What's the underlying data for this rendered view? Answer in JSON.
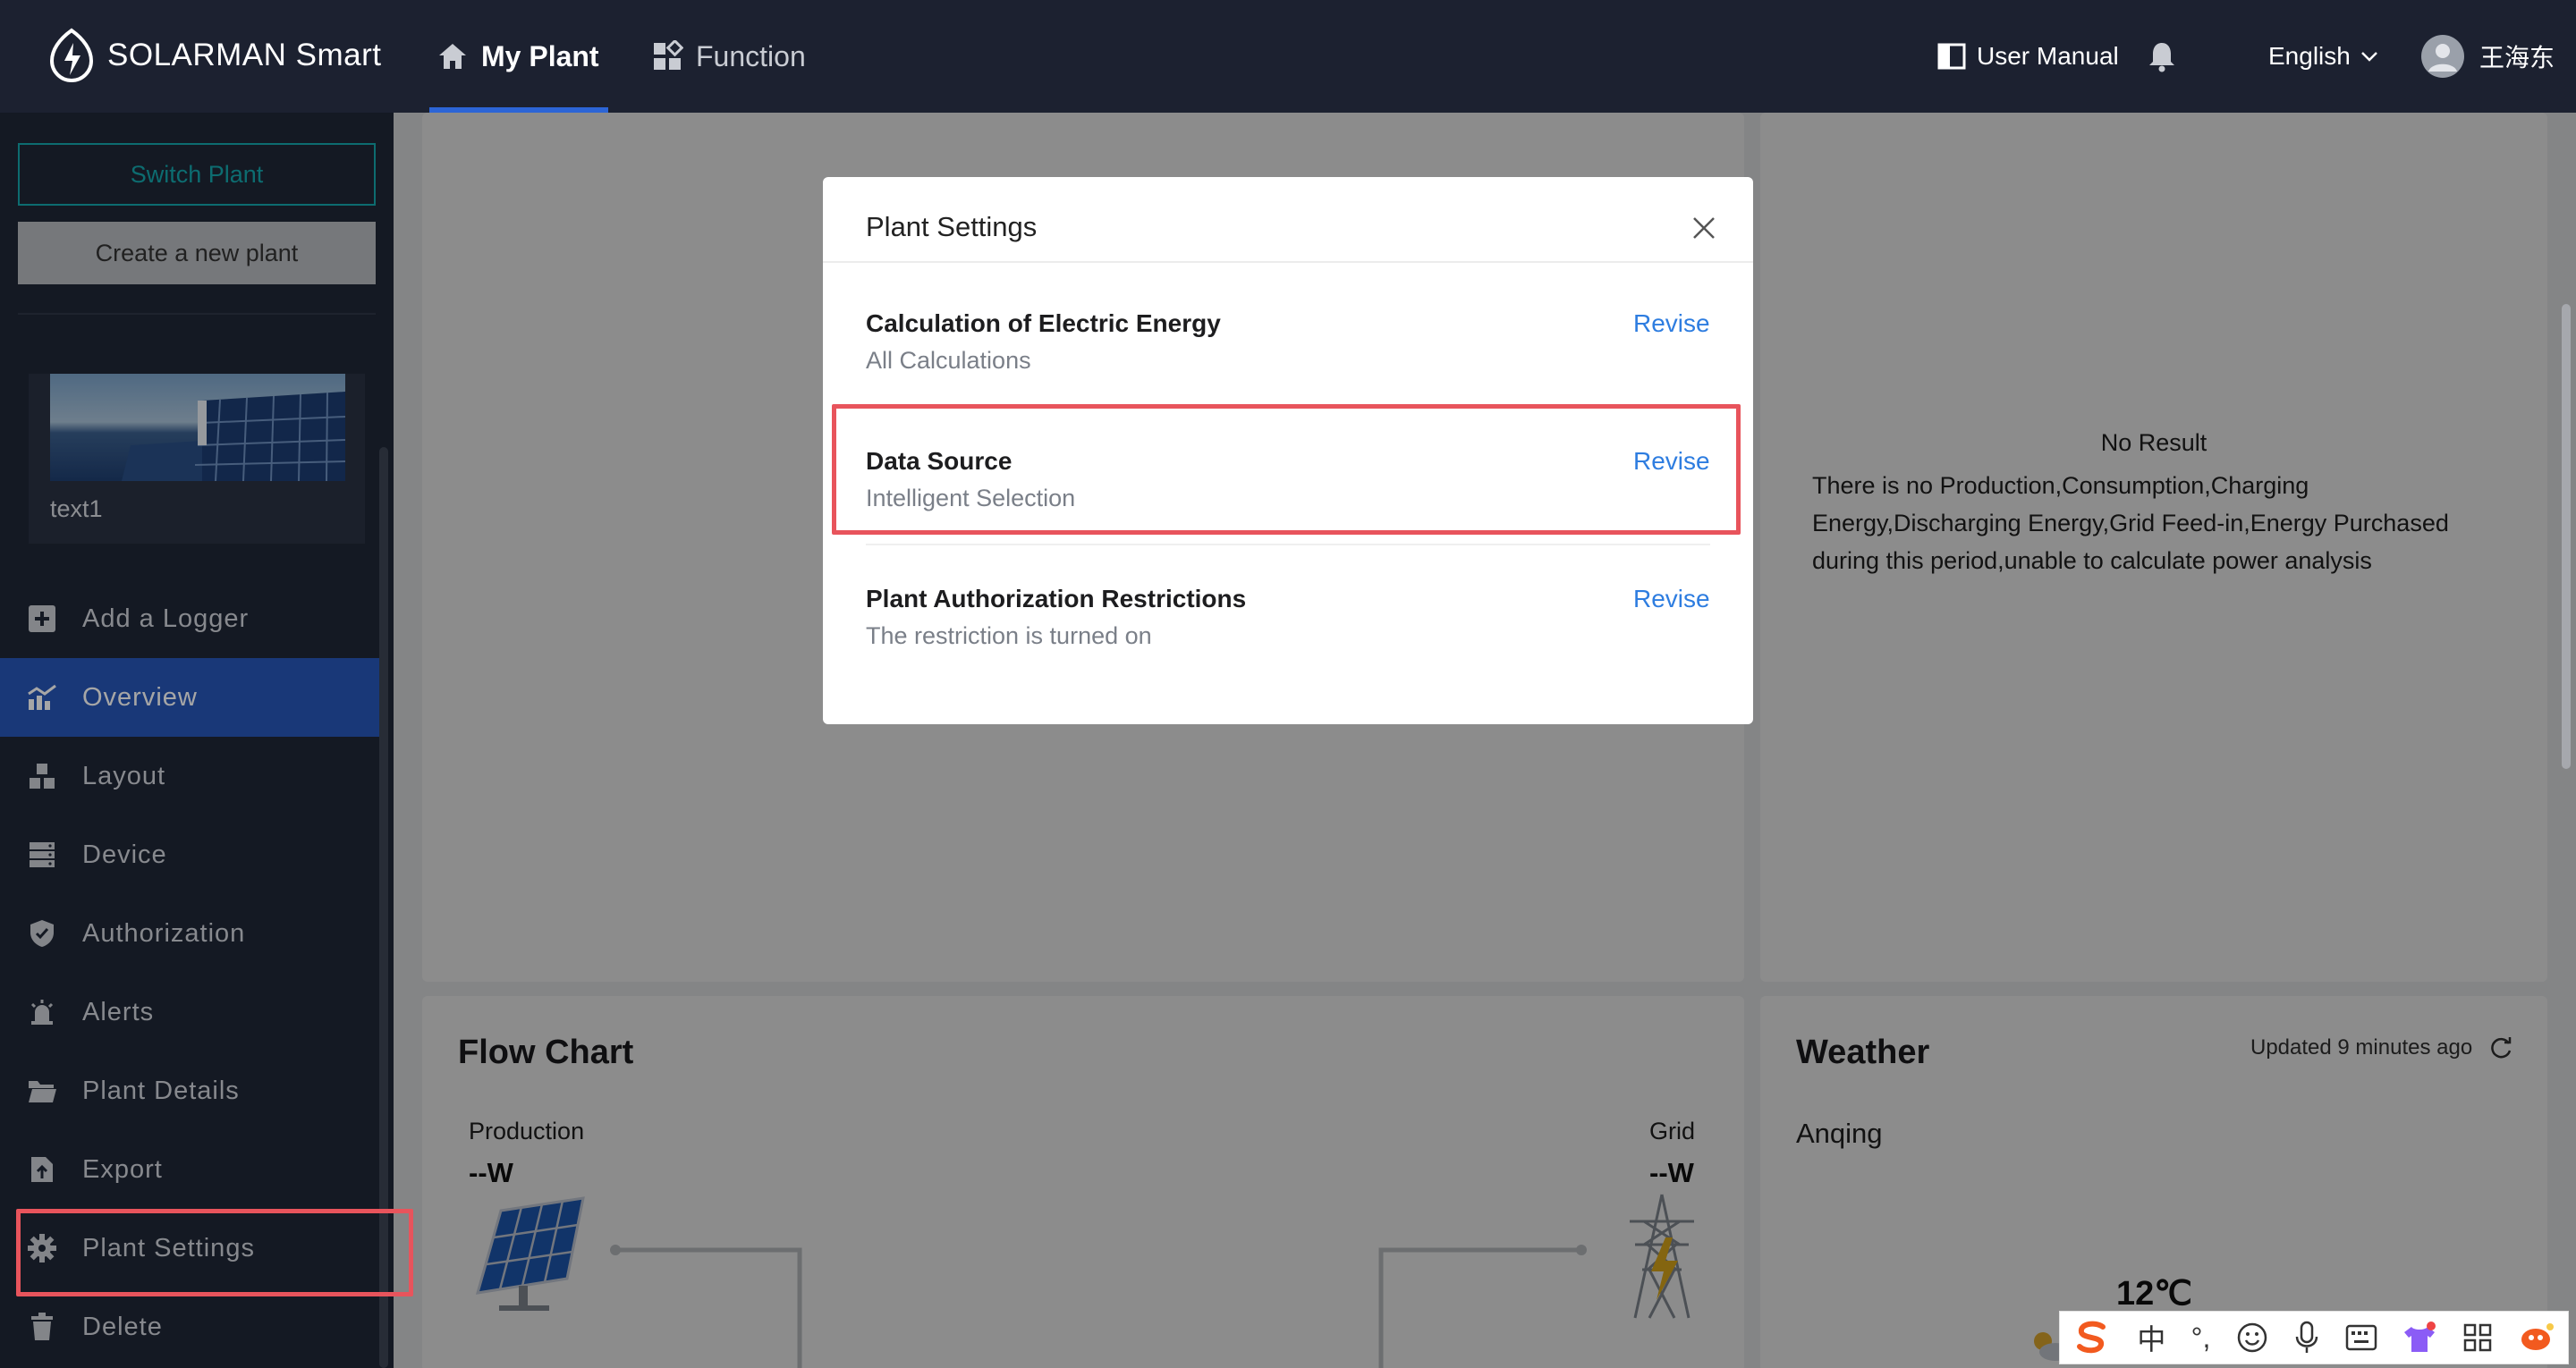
{
  "header": {
    "brand": "SOLARMAN Smart",
    "tabs": [
      {
        "label": "My Plant",
        "active": true
      },
      {
        "label": "Function",
        "active": false
      }
    ],
    "user_manual": "User Manual",
    "language": "English",
    "user_name": "王海东"
  },
  "sidebar": {
    "switch_plant": "Switch Plant",
    "create_plant": "Create a new plant",
    "plant_name": "text1",
    "items": [
      {
        "label": "Add a Logger",
        "icon": "plus-square-icon"
      },
      {
        "label": "Overview",
        "icon": "chart-icon",
        "active": true
      },
      {
        "label": "Layout",
        "icon": "layout-icon"
      },
      {
        "label": "Device",
        "icon": "server-icon"
      },
      {
        "label": "Authorization",
        "icon": "shield-icon"
      },
      {
        "label": "Alerts",
        "icon": "alarm-icon"
      },
      {
        "label": "Plant Details",
        "icon": "folder-icon"
      },
      {
        "label": "Export",
        "icon": "export-icon"
      },
      {
        "label": "Plant Settings",
        "icon": "gear-icon",
        "highlighted": true
      },
      {
        "label": "Delete",
        "icon": "trash-icon"
      }
    ]
  },
  "analysis": {
    "no_result_title": "No Result",
    "no_result_lines": [
      "There is no Production,Consumption,Charging",
      "Energy,Discharging Energy,Grid Feed-in,Energy Purchased",
      "during this period,unable to calculate power analysis"
    ]
  },
  "flow_chart": {
    "title": "Flow Chart",
    "production_label": "Production",
    "production_value": "--W",
    "grid_label": "Grid",
    "grid_value": "--W"
  },
  "weather": {
    "title": "Weather",
    "updated": "Updated 9 minutes ago",
    "city": "Anqing",
    "temperature": "12℃"
  },
  "modal": {
    "title": "Plant Settings",
    "settings": [
      {
        "label": "Calculation of Electric Energy",
        "value": "All Calculations",
        "action": "Revise"
      },
      {
        "label": "Data Source",
        "value": "Intelligent Selection",
        "action": "Revise",
        "highlighted": true
      },
      {
        "label": "Plant Authorization Restrictions",
        "value": "The restriction is turned on",
        "action": "Revise"
      }
    ]
  },
  "ime_toolbar": {
    "mode": "中",
    "punct": "°,"
  },
  "colors": {
    "topbar": "#1c2130",
    "sidebar": "#1f2736",
    "accent": "#2756b8",
    "link": "#2e7de0",
    "highlight": "#e8545c",
    "teal": "#14a6ad"
  }
}
